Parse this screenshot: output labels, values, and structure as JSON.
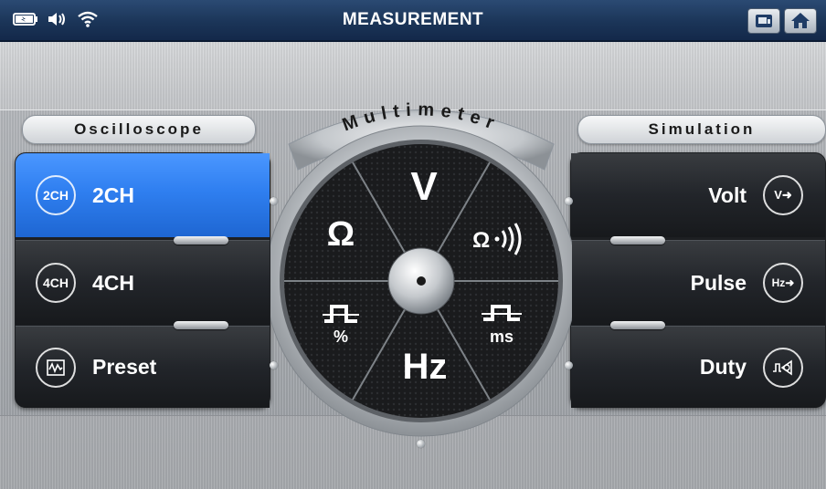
{
  "statusbar": {
    "title": "MEASUREMENT",
    "icons": [
      "battery-icon",
      "volume-icon",
      "wifi-icon"
    ],
    "right_buttons": [
      "screenshot-icon",
      "home-icon"
    ]
  },
  "oscilloscope": {
    "heading": "Oscilloscope",
    "items": [
      {
        "icon_text": "2CH",
        "label": "2CH",
        "active": true
      },
      {
        "icon_text": "4CH",
        "label": "4CH",
        "active": false
      },
      {
        "icon_name": "waveform-icon",
        "label": "Preset",
        "active": false
      }
    ]
  },
  "multimeter": {
    "heading": "Multimeter",
    "segments": {
      "top": "V",
      "upper_left": "Ω",
      "upper_right": "Ω·))",
      "lower_left_unit": "%",
      "lower_right_unit": "ms",
      "bottom": "Hz"
    }
  },
  "simulation": {
    "heading": "Simulation",
    "items": [
      {
        "label": "Volt",
        "icon_text": "V➜"
      },
      {
        "label": "Pulse",
        "icon_text": "Hz➜"
      },
      {
        "label": "Duty",
        "icon_name": "duty-cycle-icon"
      }
    ]
  },
  "colors": {
    "statusbar": "#1b3558",
    "active_button": "#2f7ff0",
    "button_dark": "#22252a"
  }
}
